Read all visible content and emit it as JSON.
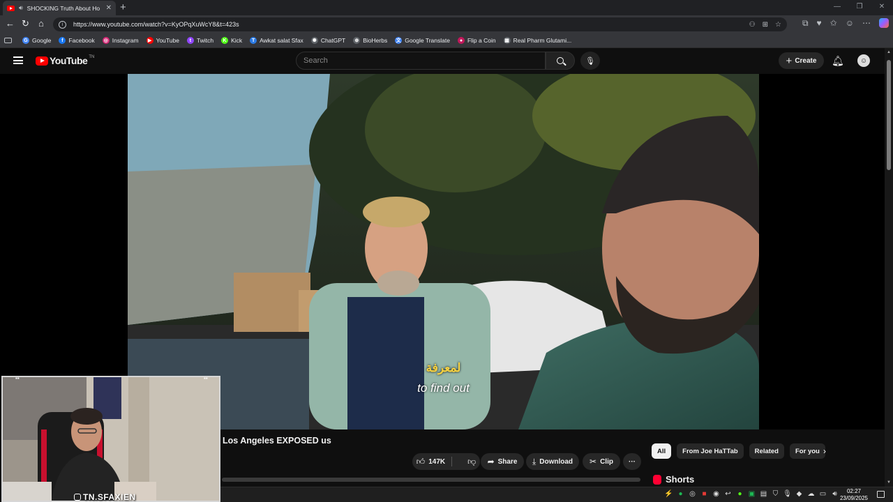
{
  "browser": {
    "tab_title": "SHOCKING Truth About Ho",
    "url": "https://www.youtube.com/watch?v=KyOPqXuWcY8&t=423s"
  },
  "bookmarks": [
    {
      "label": "Google",
      "color": "#4285f4",
      "glyph": "G"
    },
    {
      "label": "Facebook",
      "color": "#1877f2",
      "glyph": "f"
    },
    {
      "label": "Instagram",
      "color": "#d62976",
      "glyph": "◎"
    },
    {
      "label": "YouTube",
      "color": "#ff0000",
      "glyph": "▶"
    },
    {
      "label": "Twitch",
      "color": "#9146ff",
      "glyph": "t"
    },
    {
      "label": "Kick",
      "color": "#53fc18",
      "glyph": "K"
    },
    {
      "label": "Awkat salat Sfax",
      "color": "#2c7be5",
      "glyph": "T"
    },
    {
      "label": "ChatGPT",
      "color": "#5f6368",
      "glyph": "✺"
    },
    {
      "label": "BioHerbs",
      "color": "#5f6368",
      "glyph": "⊕"
    },
    {
      "label": "Google Translate",
      "color": "#4285f4",
      "glyph": "文"
    },
    {
      "label": "Flip a Coin",
      "color": "#c2185b",
      "glyph": "●"
    },
    {
      "label": "Real Pharm Glutami...",
      "color": "#5f6368",
      "glyph": "▦"
    }
  ],
  "youtube": {
    "logo_text": "YouTube",
    "country_code": "TN",
    "search_placeholder": "Search",
    "create_label": "Create"
  },
  "player": {
    "subtitle_ar": "لمعرفة",
    "subtitle_en": "to find out"
  },
  "webcam": {
    "handle": "TN.SFAXIEN"
  },
  "video": {
    "title": "Los Angeles EXPOSED us",
    "likes": "147K",
    "share_label": "Share",
    "download_label": "Download",
    "clip_label": "Clip",
    "more_label": "···"
  },
  "chips": [
    "All",
    "From Joe HaTTab",
    "Related",
    "For you"
  ],
  "shorts_label": "Shorts",
  "taskbar": {
    "time": "02:27",
    "date": "23/09/2025"
  }
}
